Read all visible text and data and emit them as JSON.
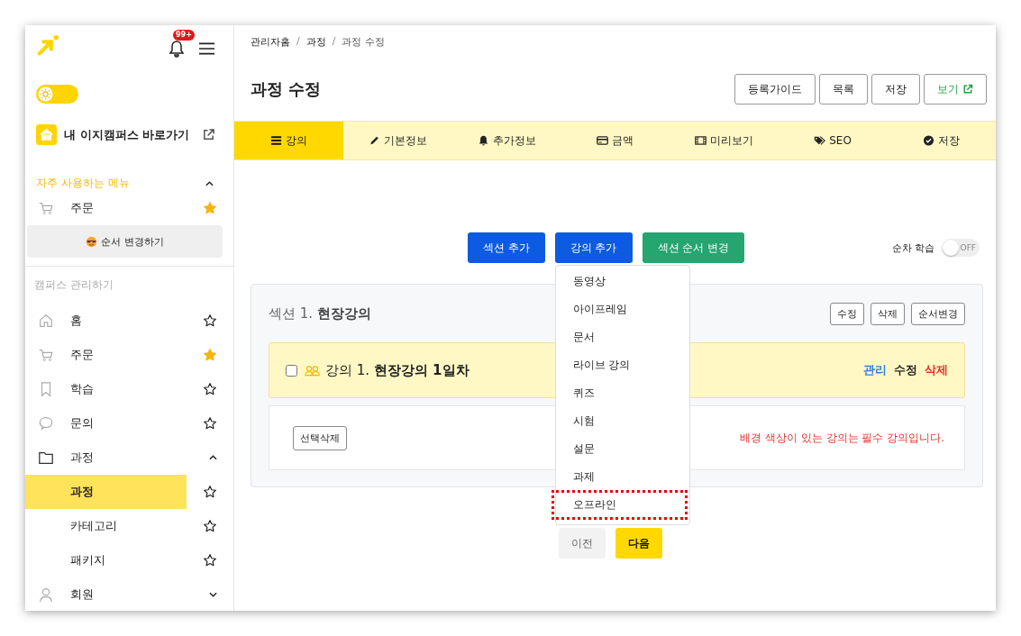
{
  "sidebar": {
    "notification_count": "99+",
    "campus_link": "내 이지캠퍼스 바로가기",
    "favorites": {
      "title": "자주 사용하는 메뉴",
      "expanded": true,
      "items": [
        {
          "label": "주문",
          "starred": true
        }
      ],
      "reorder_button": "순서 변경하기"
    },
    "section_title": "캠퍼스 관리하기",
    "menu": [
      {
        "label": "홈",
        "starred": false
      },
      {
        "label": "주문",
        "starred": true
      },
      {
        "label": "학습",
        "starred": false
      },
      {
        "label": "문의",
        "starred": false
      },
      {
        "label": "과정",
        "expanded": true,
        "children": [
          {
            "label": "과정",
            "selected": true,
            "starred": false
          },
          {
            "label": "카테고리",
            "selected": false,
            "starred": false
          },
          {
            "label": "패키지",
            "selected": false,
            "starred": false
          }
        ]
      },
      {
        "label": "회원",
        "expanded": false
      }
    ]
  },
  "theme_toggle": {
    "dark_mode": false
  },
  "breadcrumb": [
    "관리자홈",
    "과정",
    "과정 수정"
  ],
  "breadcrumb_separators": [
    "/",
    "/"
  ],
  "title": "과정 수정",
  "header_buttons": [
    {
      "label": "등록가이드",
      "kind": "plain"
    },
    {
      "label": "목록",
      "kind": "plain"
    },
    {
      "label": "저장",
      "kind": "plain"
    },
    {
      "label": "보기",
      "kind": "external"
    }
  ],
  "tabs": [
    {
      "label": "강의",
      "selected": true
    },
    {
      "label": "기본정보",
      "selected": false
    },
    {
      "label": "추가정보",
      "selected": false
    },
    {
      "label": "금액",
      "selected": false
    },
    {
      "label": "미리보기",
      "selected": false
    },
    {
      "label": "SEO",
      "selected": false
    },
    {
      "label": "저장",
      "selected": false
    }
  ],
  "actions": [
    {
      "label": "섹션 추가",
      "color": "#0d5be1"
    },
    {
      "label": "강의 추가",
      "color": "#0d5be1"
    },
    {
      "label": "섹션 순서 변경",
      "color": "#25a56f"
    }
  ],
  "sequential": {
    "label": "순차 학습",
    "on": false,
    "state_text": "OFF"
  },
  "dropdown": [
    {
      "label": "동영상",
      "highlighted": false
    },
    {
      "label": "아이프레임",
      "highlighted": false
    },
    {
      "label": "문서",
      "highlighted": false
    },
    {
      "label": "라이브 강의",
      "highlighted": false
    },
    {
      "label": "퀴즈",
      "highlighted": false
    },
    {
      "label": "시험",
      "highlighted": false
    },
    {
      "label": "설문",
      "highlighted": false
    },
    {
      "label": "과제",
      "highlighted": false
    },
    {
      "label": "오프라인",
      "highlighted": true
    }
  ],
  "section": {
    "title": "섹션 1. **현장강의**",
    "buttons": [
      "수정",
      "삭제",
      "순서변경"
    ],
    "lecture": {
      "checked": false,
      "title": "강의 1. **현장강의 1일차**",
      "links": [
        {
          "label": "관리",
          "color": "#2f7fd8"
        },
        {
          "label": "수정",
          "color": "#222222"
        },
        {
          "label": "삭제",
          "color": "#e5322d"
        }
      ]
    },
    "delete_button": "선택삭제",
    "notice": "배경 색상이 있는 강의는 필수 강의입니다."
  },
  "pager": [
    {
      "label": "이전",
      "kind": "prev"
    },
    {
      "label": "다음",
      "kind": "next"
    }
  ]
}
